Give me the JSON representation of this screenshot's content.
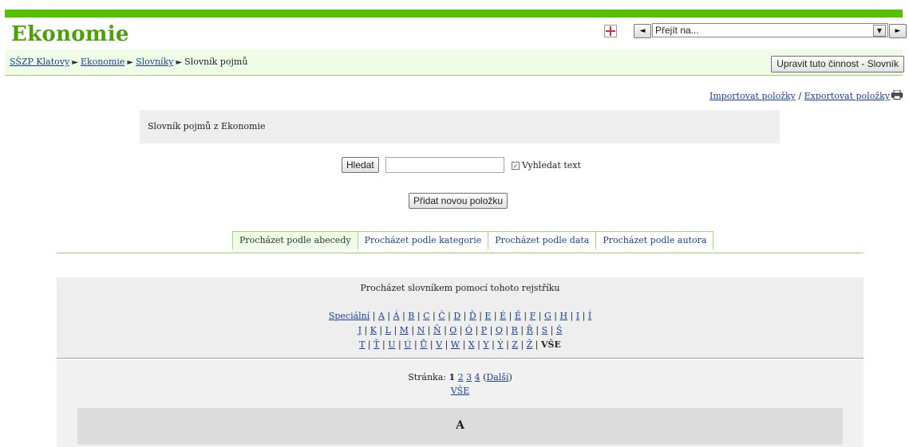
{
  "header": {
    "title": "Ekonomie",
    "jump_select": "Přejít na...",
    "prev_label": "◄",
    "next_label": "►"
  },
  "breadcrumb": {
    "items": [
      "SŠZP Klatovy",
      "Ekonomie",
      "Slovníky"
    ],
    "current": "Slovník pojmů",
    "separator": "►"
  },
  "edit_button": "Upravit tuto činnost - Slovník",
  "import_export": {
    "import": "Importovat položky",
    "sep": "/",
    "export": "Exportovat položky"
  },
  "glossary_description": "Slovník pojmů z Ekonomie",
  "search": {
    "button": "Hledat",
    "value": "",
    "fulltext_label": "Vyhledat text",
    "fulltext_checked": true
  },
  "add_entry_button": "Přidat novou položku",
  "tabs": [
    {
      "label": "Procházet podle abecedy",
      "active": true
    },
    {
      "label": "Procházet podle kategorie",
      "active": false
    },
    {
      "label": "Procházet podle data",
      "active": false
    },
    {
      "label": "Procházet podle autora",
      "active": false
    }
  ],
  "index": {
    "heading": "Procházet slovníkem pomocí tohoto rejstříku",
    "row1": [
      "Speciální",
      "A",
      "Á",
      "B",
      "C",
      "Č",
      "D",
      "Ď",
      "E",
      "É",
      "Ě",
      "F",
      "G",
      "H",
      "I",
      "Í"
    ],
    "row2": [
      "J",
      "K",
      "L",
      "M",
      "N",
      "Ň",
      "O",
      "Ó",
      "P",
      "Q",
      "R",
      "Ř",
      "S",
      "Š"
    ],
    "row3": [
      "T",
      "Ť",
      "U",
      "Ú",
      "Ů",
      "V",
      "W",
      "X",
      "Y",
      "Ý",
      "Z",
      "Ž"
    ],
    "all_label": "VŠE"
  },
  "pager": {
    "label": "Stránka:",
    "current": "1",
    "pages": [
      "2",
      "3",
      "4"
    ],
    "next": "Další",
    "all": "VŠE"
  },
  "letter_heading": "A",
  "colors": {
    "accent": "#56c100",
    "title": "#4aa10a",
    "crumb_bg": "#effde6"
  }
}
